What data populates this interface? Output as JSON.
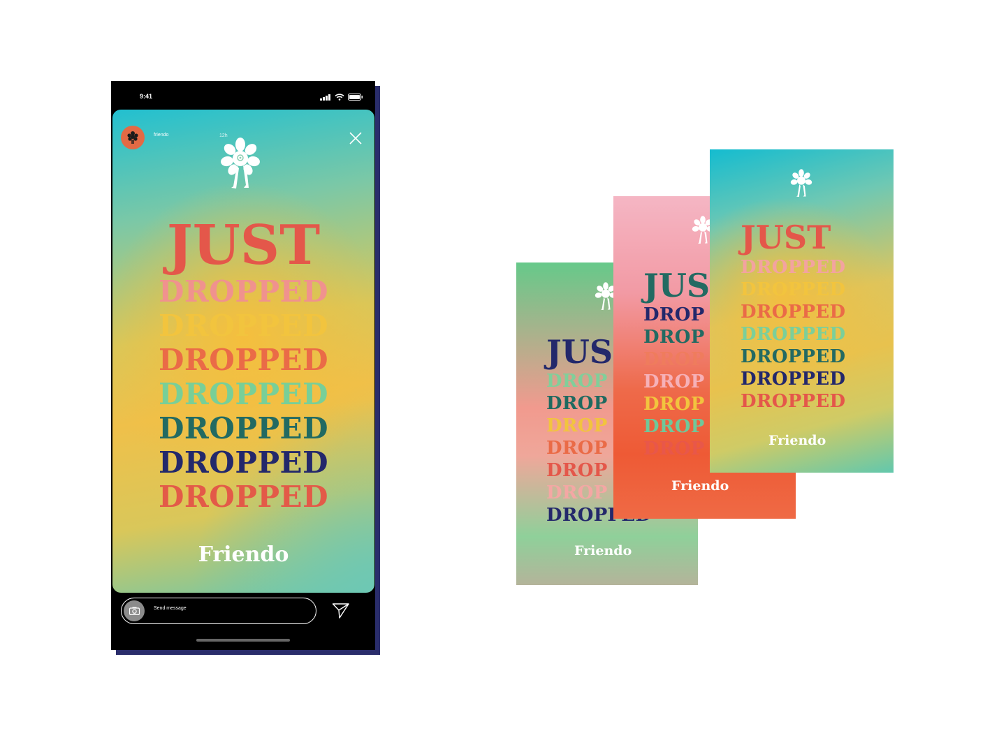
{
  "phone": {
    "status_time": "9:41",
    "story": {
      "username": "friendo",
      "time_ago": "12h",
      "headline": "JUST",
      "repeated_word": "DROPPED",
      "drop_colors": [
        "#f0928e",
        "#f2c43e",
        "#ea6b47",
        "#78cf98",
        "#226a62",
        "#23286b",
        "#e35a48"
      ],
      "headline_color": "#e4574a",
      "brand": "Friendo"
    },
    "message_placeholder": "Send message"
  },
  "cards": [
    {
      "id": "green",
      "headline": "JUS",
      "headline_color": "#23286b",
      "words": [
        "DROP",
        "DROP",
        "DROP",
        "DROP",
        "DROP",
        "DROP",
        "DROPPED"
      ],
      "colors": [
        "#80cf9a",
        "#1f6a60",
        "#f2c43e",
        "#ea6b47",
        "#e4574a",
        "#f4a7a4",
        "#23286b"
      ],
      "brand": "Friendo"
    },
    {
      "id": "pink",
      "headline": "JUS",
      "headline_color": "#236a62",
      "words": [
        "DROP",
        "DROP",
        "DROP",
        "DROP",
        "DROP",
        "DROP",
        "DROP"
      ],
      "colors": [
        "#23286b",
        "#236a62",
        "#ef7c5d",
        "#f6b1b8",
        "#f2c43e",
        "#6fc89a",
        "#e8574a"
      ],
      "brand": "Friendo"
    },
    {
      "id": "teal",
      "headline": "JUST",
      "headline_color": "#e4574a",
      "words": [
        "DROPPED",
        "DROPPED",
        "DROPPED",
        "DROPPED",
        "DROPPED",
        "DROPPED",
        "DROPPED"
      ],
      "colors": [
        "#f3a3a0",
        "#f2c43e",
        "#ea6b47",
        "#7bcf9a",
        "#236a62",
        "#23286b",
        "#e4574a"
      ],
      "brand": "Friendo"
    }
  ]
}
